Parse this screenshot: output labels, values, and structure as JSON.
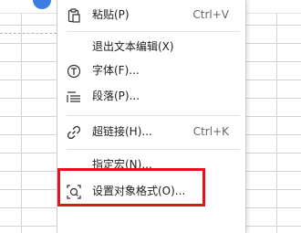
{
  "context_menu": {
    "paste": {
      "label": "粘贴(P)",
      "shortcut": "Ctrl+V",
      "icon": "clipboard-icon"
    },
    "exit_text_edit": {
      "label": "退出文本编辑(X)"
    },
    "font": {
      "label": "字体(F)...",
      "icon": "font-icon"
    },
    "paragraph": {
      "label": "段落(P)...",
      "icon": "paragraph-icon"
    },
    "hyperlink": {
      "label": "超链接(H)...",
      "shortcut": "Ctrl+K",
      "icon": "link-icon"
    },
    "assign_macro": {
      "label": "指定宏(N)..."
    },
    "format_object": {
      "label": "设置对象格式(O)...",
      "icon": "format-object-icon"
    }
  },
  "colors": {
    "highlight_border": "#e0141a",
    "grid_line": "#d4d4d4"
  }
}
